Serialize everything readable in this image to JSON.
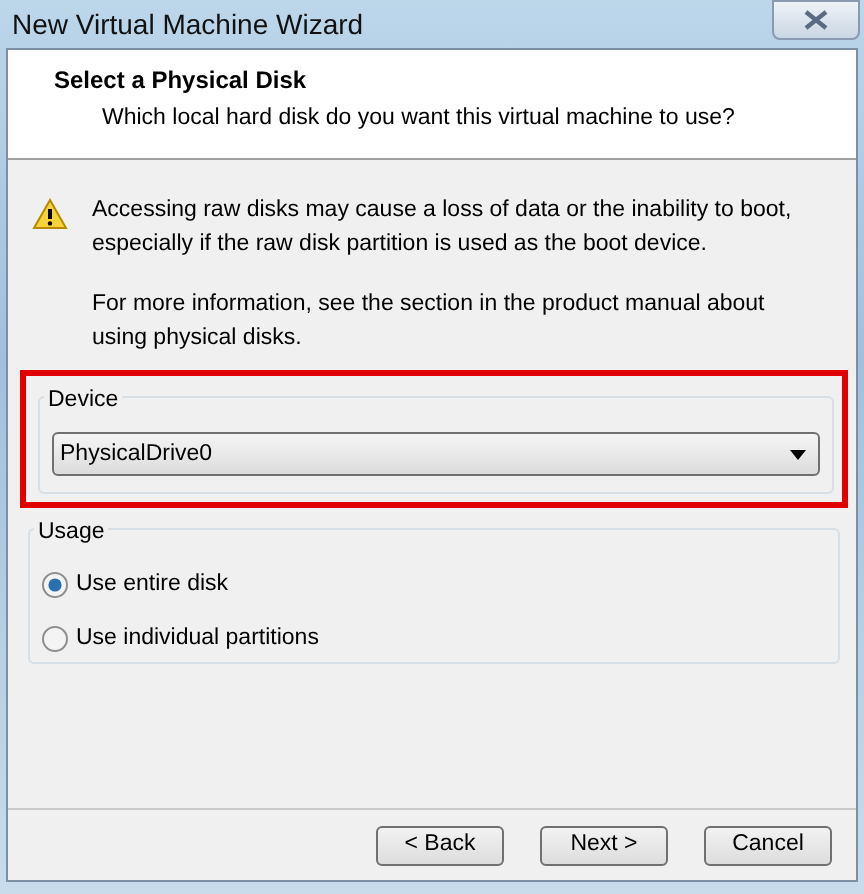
{
  "window": {
    "title": "New Virtual Machine Wizard"
  },
  "header": {
    "title": "Select a Physical Disk",
    "subtitle": "Which local hard disk do you want this virtual machine to use?"
  },
  "warning": {
    "text": "Accessing raw disks may cause a loss of data or the inability to boot, especially if the raw disk partition is used as the boot device.",
    "info": "For more information, see the section in the product manual about using physical disks."
  },
  "device": {
    "label": "Device",
    "value": "PhysicalDrive0",
    "highlighted": true
  },
  "usage": {
    "label": "Usage",
    "options": [
      {
        "label": "Use entire disk",
        "selected": true
      },
      {
        "label": "Use individual partitions",
        "selected": false
      }
    ]
  },
  "buttons": [
    {
      "label": "< Back"
    },
    {
      "label": "Next >"
    },
    {
      "label": "Cancel"
    }
  ]
}
